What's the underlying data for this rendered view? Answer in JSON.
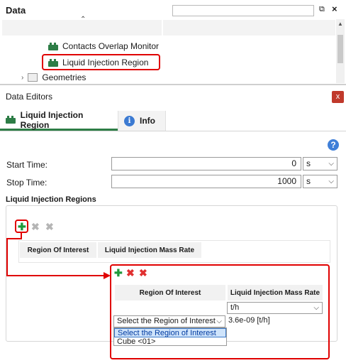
{
  "data_panel": {
    "title": "Data",
    "search_value": "",
    "tree": {
      "contacts_label": "Contacts Overlap Monitor",
      "liquid_label": "Liquid Injection Region",
      "geometries_label": "Geometries"
    }
  },
  "editors": {
    "title": "Data Editors",
    "close_label": "x",
    "tabs": [
      {
        "label": "Liquid Injection Region"
      },
      {
        "label": "Info"
      }
    ],
    "start_time": {
      "label": "Start Time:",
      "value": "0",
      "unit": "s"
    },
    "stop_time": {
      "label": "Stop Time:",
      "value": "1000",
      "unit": "s"
    },
    "group_title": "Liquid Injection Regions",
    "table": {
      "headers": [
        "Region Of Interest",
        "Liquid Injection Mass Rate"
      ]
    },
    "zoom": {
      "headers": [
        "Region Of Interest",
        "Liquid Injection Mass Rate"
      ],
      "unit_select": "t/h",
      "region_select": "Select the Region of Interest",
      "rate_value": "3.6e-09 [t/h]",
      "options": [
        "Select the Region of Interest",
        "Cube <01>"
      ]
    }
  },
  "colors": {
    "accent_green": "#2d7d46",
    "highlight_red": "#e00000"
  }
}
